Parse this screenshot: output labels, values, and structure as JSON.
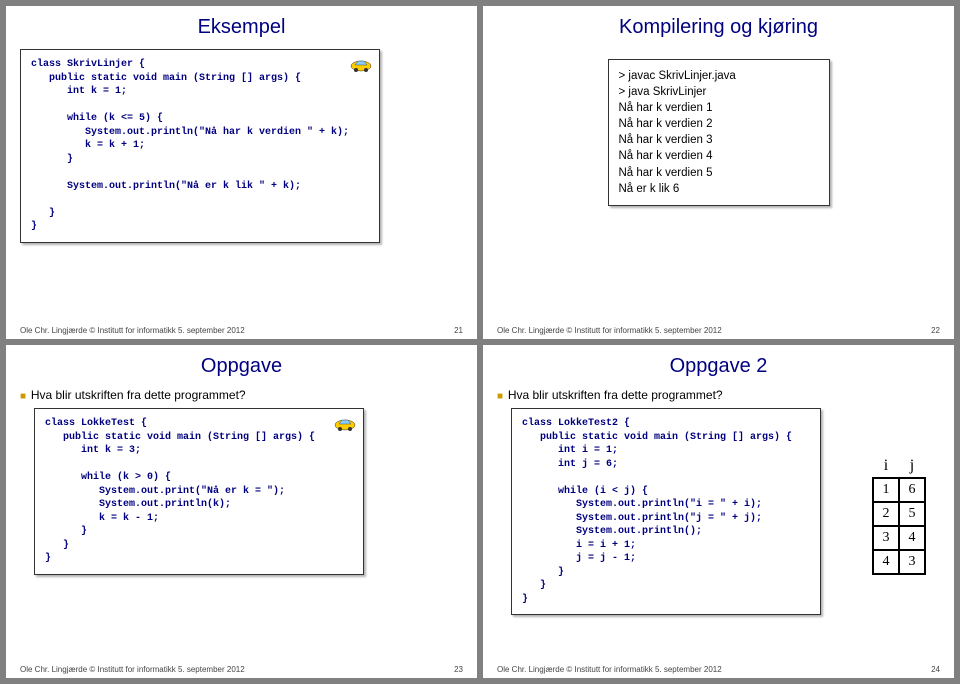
{
  "footer": {
    "left": "Ole Chr. Lingjærde © Institutt for informatikk  5. september 2012"
  },
  "slide1": {
    "title": "Eksempel",
    "code": "class SkrivLinjer {\n   public static void main (String [] args) {\n      int k = 1;\n\n      while (k <= 5) {\n         System.out.println(\"Nå har k verdien \" + k);\n         k = k + 1;\n      }\n\n      System.out.println(\"Nå er k lik \" + k);\n\n   }\n}",
    "page": "21"
  },
  "slide2": {
    "title": "Kompilering og kjøring",
    "output": "> javac SkrivLinjer.java\n> java SkrivLinjer\nNå har k verdien 1\nNå har k verdien 2\nNå har k verdien 3\nNå har k verdien 4\nNå har k verdien 5\nNå er k lik 6",
    "page": "22"
  },
  "slide3": {
    "title": "Oppgave",
    "bullet": "Hva blir utskriften fra dette programmet?",
    "code": "class LokkeTest {\n   public static void main (String [] args) {\n      int k = 3;\n\n      while (k > 0) {\n         System.out.print(\"Nå er k = \");\n         System.out.println(k);\n         k = k - 1;\n      }\n   }\n}",
    "page": "23"
  },
  "slide4": {
    "title": "Oppgave 2",
    "bullet": "Hva blir utskriften fra dette programmet?",
    "code": "class LokkeTest2 {\n   public static void main (String [] args) {\n      int i = 1;\n      int j = 6;\n\n      while (i < j) {\n         System.out.println(\"i = \" + i);\n         System.out.println(\"j = \" + j);\n         System.out.println();\n         i = i + 1;\n         j = j - 1;\n      }\n   }\n}",
    "page": "24",
    "table": {
      "headers": [
        "i",
        "j"
      ],
      "rows": [
        [
          "1",
          "6"
        ],
        [
          "2",
          "5"
        ],
        [
          "3",
          "4"
        ],
        [
          "4",
          "3"
        ]
      ]
    }
  }
}
